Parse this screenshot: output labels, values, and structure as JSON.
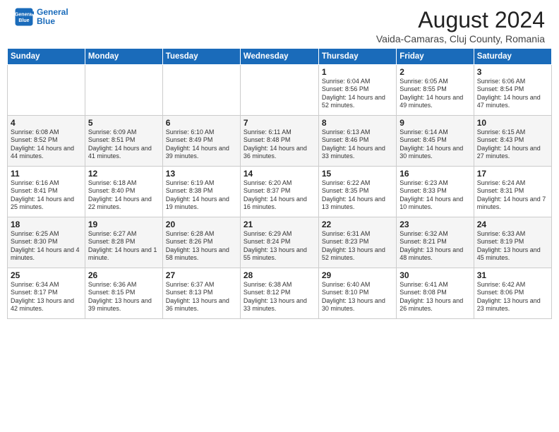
{
  "header": {
    "logo_line1": "General",
    "logo_line2": "Blue",
    "title": "August 2024",
    "subtitle": "Vaida-Camaras, Cluj County, Romania"
  },
  "calendar": {
    "columns": [
      "Sunday",
      "Monday",
      "Tuesday",
      "Wednesday",
      "Thursday",
      "Friday",
      "Saturday"
    ],
    "weeks": [
      [
        {
          "num": "",
          "info": ""
        },
        {
          "num": "",
          "info": ""
        },
        {
          "num": "",
          "info": ""
        },
        {
          "num": "",
          "info": ""
        },
        {
          "num": "1",
          "info": "Sunrise: 6:04 AM\nSunset: 8:56 PM\nDaylight: 14 hours and 52 minutes."
        },
        {
          "num": "2",
          "info": "Sunrise: 6:05 AM\nSunset: 8:55 PM\nDaylight: 14 hours and 49 minutes."
        },
        {
          "num": "3",
          "info": "Sunrise: 6:06 AM\nSunset: 8:54 PM\nDaylight: 14 hours and 47 minutes."
        }
      ],
      [
        {
          "num": "4",
          "info": "Sunrise: 6:08 AM\nSunset: 8:52 PM\nDaylight: 14 hours and 44 minutes."
        },
        {
          "num": "5",
          "info": "Sunrise: 6:09 AM\nSunset: 8:51 PM\nDaylight: 14 hours and 41 minutes."
        },
        {
          "num": "6",
          "info": "Sunrise: 6:10 AM\nSunset: 8:49 PM\nDaylight: 14 hours and 39 minutes."
        },
        {
          "num": "7",
          "info": "Sunrise: 6:11 AM\nSunset: 8:48 PM\nDaylight: 14 hours and 36 minutes."
        },
        {
          "num": "8",
          "info": "Sunrise: 6:13 AM\nSunset: 8:46 PM\nDaylight: 14 hours and 33 minutes."
        },
        {
          "num": "9",
          "info": "Sunrise: 6:14 AM\nSunset: 8:45 PM\nDaylight: 14 hours and 30 minutes."
        },
        {
          "num": "10",
          "info": "Sunrise: 6:15 AM\nSunset: 8:43 PM\nDaylight: 14 hours and 27 minutes."
        }
      ],
      [
        {
          "num": "11",
          "info": "Sunrise: 6:16 AM\nSunset: 8:41 PM\nDaylight: 14 hours and 25 minutes."
        },
        {
          "num": "12",
          "info": "Sunrise: 6:18 AM\nSunset: 8:40 PM\nDaylight: 14 hours and 22 minutes."
        },
        {
          "num": "13",
          "info": "Sunrise: 6:19 AM\nSunset: 8:38 PM\nDaylight: 14 hours and 19 minutes."
        },
        {
          "num": "14",
          "info": "Sunrise: 6:20 AM\nSunset: 8:37 PM\nDaylight: 14 hours and 16 minutes."
        },
        {
          "num": "15",
          "info": "Sunrise: 6:22 AM\nSunset: 8:35 PM\nDaylight: 14 hours and 13 minutes."
        },
        {
          "num": "16",
          "info": "Sunrise: 6:23 AM\nSunset: 8:33 PM\nDaylight: 14 hours and 10 minutes."
        },
        {
          "num": "17",
          "info": "Sunrise: 6:24 AM\nSunset: 8:31 PM\nDaylight: 14 hours and 7 minutes."
        }
      ],
      [
        {
          "num": "18",
          "info": "Sunrise: 6:25 AM\nSunset: 8:30 PM\nDaylight: 14 hours and 4 minutes."
        },
        {
          "num": "19",
          "info": "Sunrise: 6:27 AM\nSunset: 8:28 PM\nDaylight: 14 hours and 1 minute."
        },
        {
          "num": "20",
          "info": "Sunrise: 6:28 AM\nSunset: 8:26 PM\nDaylight: 13 hours and 58 minutes."
        },
        {
          "num": "21",
          "info": "Sunrise: 6:29 AM\nSunset: 8:24 PM\nDaylight: 13 hours and 55 minutes."
        },
        {
          "num": "22",
          "info": "Sunrise: 6:31 AM\nSunset: 8:23 PM\nDaylight: 13 hours and 52 minutes."
        },
        {
          "num": "23",
          "info": "Sunrise: 6:32 AM\nSunset: 8:21 PM\nDaylight: 13 hours and 48 minutes."
        },
        {
          "num": "24",
          "info": "Sunrise: 6:33 AM\nSunset: 8:19 PM\nDaylight: 13 hours and 45 minutes."
        }
      ],
      [
        {
          "num": "25",
          "info": "Sunrise: 6:34 AM\nSunset: 8:17 PM\nDaylight: 13 hours and 42 minutes."
        },
        {
          "num": "26",
          "info": "Sunrise: 6:36 AM\nSunset: 8:15 PM\nDaylight: 13 hours and 39 minutes."
        },
        {
          "num": "27",
          "info": "Sunrise: 6:37 AM\nSunset: 8:13 PM\nDaylight: 13 hours and 36 minutes."
        },
        {
          "num": "28",
          "info": "Sunrise: 6:38 AM\nSunset: 8:12 PM\nDaylight: 13 hours and 33 minutes."
        },
        {
          "num": "29",
          "info": "Sunrise: 6:40 AM\nSunset: 8:10 PM\nDaylight: 13 hours and 30 minutes."
        },
        {
          "num": "30",
          "info": "Sunrise: 6:41 AM\nSunset: 8:08 PM\nDaylight: 13 hours and 26 minutes."
        },
        {
          "num": "31",
          "info": "Sunrise: 6:42 AM\nSunset: 8:06 PM\nDaylight: 13 hours and 23 minutes."
        }
      ]
    ]
  }
}
